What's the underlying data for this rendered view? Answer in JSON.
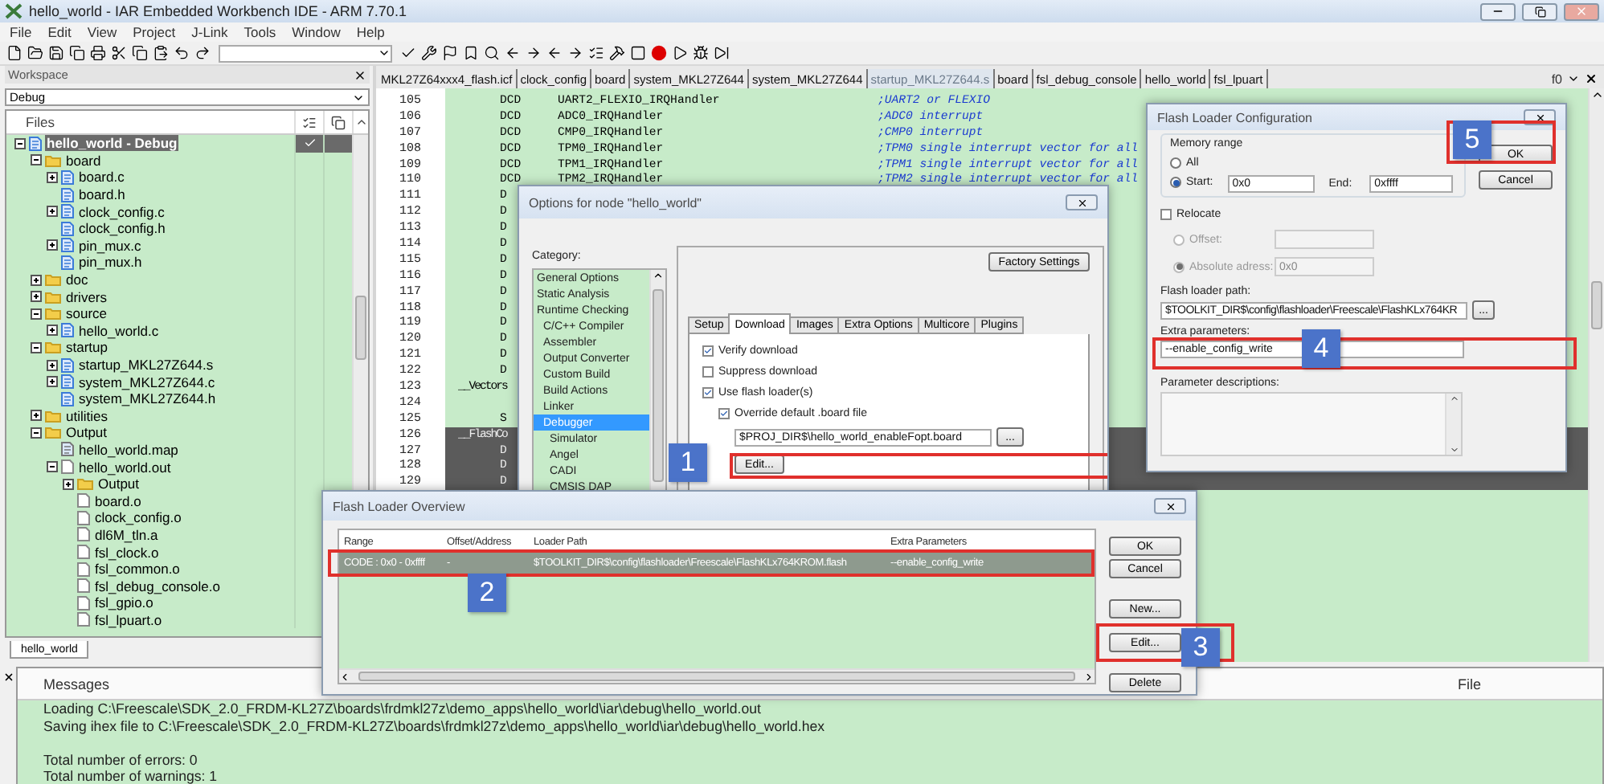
{
  "window": {
    "title": "hello_world - IAR Embedded Workbench IDE - ARM 7.70.1"
  },
  "menu": [
    "File",
    "Edit",
    "View",
    "Project",
    "J-Link",
    "Tools",
    "Window",
    "Help"
  ],
  "workspace": {
    "title": "Workspace",
    "configuration": "Debug",
    "files_header": "Files",
    "bottom_tab": "hello_world",
    "tree": [
      {
        "label": "hello_world - Debug",
        "kind": "project",
        "selected": true,
        "checked": true,
        "expanded": true,
        "children": [
          {
            "label": "board",
            "kind": "folder",
            "selected": false,
            "expanded": true,
            "children": [
              {
                "label": "board.c",
                "kind": "source",
                "selected": false,
                "expanded": false
              },
              {
                "label": "board.h",
                "kind": "header",
                "selected": false
              },
              {
                "label": "clock_config.c",
                "kind": "source",
                "selected": false,
                "expanded": false
              },
              {
                "label": "clock_config.h",
                "kind": "header",
                "selected": false
              },
              {
                "label": "pin_mux.c",
                "kind": "source",
                "selected": false,
                "expanded": false
              },
              {
                "label": "pin_mux.h",
                "kind": "header",
                "selected": false
              }
            ]
          },
          {
            "label": "doc",
            "kind": "folder",
            "selected": false,
            "expanded": false
          },
          {
            "label": "drivers",
            "kind": "folder",
            "selected": false,
            "expanded": false
          },
          {
            "label": "source",
            "kind": "folder",
            "selected": false,
            "expanded": true,
            "children": [
              {
                "label": "hello_world.c",
                "kind": "source",
                "selected": false,
                "expanded": false
              }
            ]
          },
          {
            "label": "startup",
            "kind": "folder",
            "selected": false,
            "expanded": true,
            "children": [
              {
                "label": "startup_MKL27Z644.s",
                "kind": "assembly",
                "selected": false,
                "expanded": false
              },
              {
                "label": "system_MKL27Z644.c",
                "kind": "source",
                "selected": false,
                "expanded": false
              },
              {
                "label": "system_MKL27Z644.h",
                "kind": "header",
                "selected": false
              }
            ]
          },
          {
            "label": "utilities",
            "kind": "folder",
            "selected": false,
            "expanded": false
          },
          {
            "label": "Output",
            "kind": "folder",
            "selected": false,
            "expanded": true,
            "children": [
              {
                "label": "hello_world.map",
                "kind": "map",
                "selected": false
              },
              {
                "label": "hello_world.out",
                "kind": "object",
                "selected": false,
                "expanded": true,
                "children": [
                  {
                    "label": "Output",
                    "kind": "folder",
                    "selected": false,
                    "expanded": false
                  },
                  {
                    "label": "board.o",
                    "kind": "object",
                    "selected": false
                  },
                  {
                    "label": "clock_config.o",
                    "kind": "object",
                    "selected": false
                  },
                  {
                    "label": "dl6M_tln.a",
                    "kind": "object",
                    "selected": false
                  },
                  {
                    "label": "fsl_clock.o",
                    "kind": "object",
                    "selected": false
                  },
                  {
                    "label": "fsl_common.o",
                    "kind": "object",
                    "selected": false
                  },
                  {
                    "label": "fsl_debug_console.o",
                    "kind": "object",
                    "selected": false
                  },
                  {
                    "label": "fsl_gpio.o",
                    "kind": "object",
                    "selected": false
                  },
                  {
                    "label": "fsl_lpuart.o",
                    "kind": "object",
                    "selected": false
                  }
                ]
              }
            ]
          }
        ]
      }
    ]
  },
  "editor": {
    "tab_menu": "f0",
    "tabs": [
      {
        "label": "MKL27Z64xxx4_flash.icf",
        "selected": false
      },
      {
        "label": "clock_config",
        "selected": false
      },
      {
        "label": "board",
        "selected": false
      },
      {
        "label": "system_MKL27Z644",
        "selected": false
      },
      {
        "label": "system_MKL27Z644",
        "selected": false
      },
      {
        "label": "startup_MKL27Z644.s",
        "selected": true
      },
      {
        "label": "board",
        "selected": false
      },
      {
        "label": "fsl_debug_console",
        "selected": false
      },
      {
        "label": "hello_world",
        "selected": false
      },
      {
        "label": "fsl_lpuart",
        "selected": false
      }
    ],
    "lines": [
      {
        "number": "105",
        "op": "DCD",
        "arg": "UART2_FLEXIO_IRQHandler",
        "comment": ";UART2 or FLEXIO",
        "selected": false
      },
      {
        "number": "106",
        "op": "DCD",
        "arg": "ADC0_IRQHandler",
        "comment": ";ADC0 interrupt",
        "selected": false
      },
      {
        "number": "107",
        "op": "DCD",
        "arg": "CMP0_IRQHandler",
        "comment": ";CMP0 interrupt",
        "selected": false
      },
      {
        "number": "108",
        "op": "DCD",
        "arg": "TPM0_IRQHandler",
        "comment": ";TPM0 single interrupt vector for all",
        "selected": false
      },
      {
        "number": "109",
        "op": "DCD",
        "arg": "TPM1_IRQHandler",
        "comment": ";TPM1 single interrupt vector for all",
        "selected": false
      },
      {
        "number": "110",
        "op": "DCD",
        "arg": "TPM2_IRQHandler",
        "comment": ";TPM2 single interrupt vector for all",
        "selected": false
      },
      {
        "number": "111",
        "op": "D",
        "selected": false
      },
      {
        "number": "112",
        "op": "D",
        "selected": false
      },
      {
        "number": "113",
        "op": "D",
        "selected": false
      },
      {
        "number": "114",
        "op": "D",
        "selected": false
      },
      {
        "number": "115",
        "op": "D",
        "selected": false
      },
      {
        "number": "116",
        "op": "D",
        "selected": false
      },
      {
        "number": "117",
        "op": "D",
        "selected": false
      },
      {
        "number": "118",
        "op": "D",
        "selected": false
      },
      {
        "number": "119",
        "op": "D",
        "selected": false
      },
      {
        "number": "120",
        "op": "D",
        "selected": false
      },
      {
        "number": "121",
        "op": "D",
        "selected": false
      },
      {
        "number": "122",
        "op": "D",
        "selected": false
      },
      {
        "number": "123",
        "label": "__Vectors",
        "selected": false
      },
      {
        "number": "124",
        "selected": false
      },
      {
        "number": "125",
        "op": "S",
        "selected": false
      },
      {
        "number": "126",
        "label": "__FlashCo",
        "selected": true
      },
      {
        "number": "127",
        "op": "D",
        "selected": true
      },
      {
        "number": "128",
        "op": "D",
        "selected": true
      },
      {
        "number": "129",
        "op": "D",
        "selected": true
      }
    ]
  },
  "options_dialog": {
    "title": "Options for node \"hello_world\"",
    "category_label": "Category:",
    "categories": [
      {
        "label": "General Options",
        "selected": false
      },
      {
        "label": "Static Analysis",
        "selected": false
      },
      {
        "label": "Runtime Checking",
        "selected": false,
        "children": [
          {
            "label": "C/C++ Compiler",
            "selected": false
          },
          {
            "label": "Assembler",
            "selected": false
          },
          {
            "label": "Output Converter",
            "selected": false
          },
          {
            "label": "Custom Build",
            "selected": false
          },
          {
            "label": "Build Actions",
            "selected": false
          },
          {
            "label": "Linker",
            "selected": false
          },
          {
            "label": "Debugger",
            "selected": true,
            "children": [
              {
                "label": "Simulator",
                "selected": false
              },
              {
                "label": "Angel",
                "selected": false
              },
              {
                "label": "CADI",
                "selected": false
              },
              {
                "label": "CMSIS DAP",
                "selected": false
              }
            ]
          }
        ]
      }
    ],
    "factory_button": "Factory Settings",
    "tabs": [
      {
        "label": "Setup",
        "selected": false
      },
      {
        "label": "Download",
        "selected": true
      },
      {
        "label": "Images",
        "selected": false
      },
      {
        "label": "Extra Options",
        "selected": false
      },
      {
        "label": "Multicore",
        "selected": false
      },
      {
        "label": "Plugins",
        "selected": false
      }
    ],
    "checks": [
      {
        "label": "Verify download",
        "checked": true
      },
      {
        "label": "Suppress download",
        "checked": false
      },
      {
        "label": "Use flash loader(s)",
        "checked": true,
        "children": [
          {
            "label": "Override default .board file",
            "checked": true
          }
        ]
      }
    ],
    "board_file": "$PROJ_DIR$\\hello_world_enableFopt.board",
    "browse_button": "...",
    "edit_button": {
      "label": "Edit...",
      "callout": "1"
    }
  },
  "overview_dialog": {
    "title": "Flash Loader Overview",
    "columns": [
      "Range",
      "Offset/Address",
      "Loader Path",
      "Extra Parameters"
    ],
    "rows": [
      {
        "cells": [
          "CODE : 0x0 - 0xffff",
          "-",
          "$TOOLKIT_DIR$\\config\\flashloader\\Freescale\\FlashKLx764KROM.flash",
          "--enable_config_write"
        ],
        "selected": true,
        "callout": "2"
      }
    ],
    "buttons": [
      {
        "label": "OK"
      },
      {
        "label": "Cancel"
      },
      {
        "label": "New..."
      },
      {
        "label": "Edit...",
        "callout": "3"
      },
      {
        "label": "Delete"
      }
    ]
  },
  "config_dialog": {
    "title": "Flash Loader Configuration",
    "range_label": "Memory range",
    "range_options": [
      {
        "label": "All",
        "selected": false
      },
      {
        "label": "Start:",
        "selected": true
      }
    ],
    "start": "0x0",
    "end_label": "End:",
    "end": "0xffff",
    "buttons": [
      {
        "label": "OK",
        "callout": "5"
      },
      {
        "label": "Cancel"
      }
    ],
    "relocate": {
      "label": "Relocate",
      "checked": false,
      "options": [
        {
          "label": "Offset:",
          "selected": false
        },
        {
          "label": "Absolute adress:",
          "selected": true,
          "value": "0x0"
        }
      ]
    },
    "path_label": "Flash loader path:",
    "path": "$TOOLKIT_DIR$\\config\\flashloader\\Freescale\\FlashKLx764KR",
    "browse_button": "...",
    "extra_label": "Extra parameters:",
    "extra": {
      "value": "--enable_config_write",
      "callout": "4"
    },
    "descriptions_label": "Parameter descriptions:"
  },
  "messages": {
    "columns": [
      "Messages",
      "File"
    ],
    "blocks": [
      [
        "Loading C:\\Freescale\\SDK_2.0_FRDM-KL27Z\\boards\\frdmkl27z\\demo_apps\\hello_world\\iar\\debug\\hello_world.out",
        "Saving ihex file to C:\\Freescale\\SDK_2.0_FRDM-KL27Z\\boards\\frdmkl27z\\demo_apps\\hello_world\\iar\\debug\\hello_world.hex"
      ],
      [
        "Total number of errors: 0",
        "Total number of warnings: 1"
      ]
    ]
  }
}
